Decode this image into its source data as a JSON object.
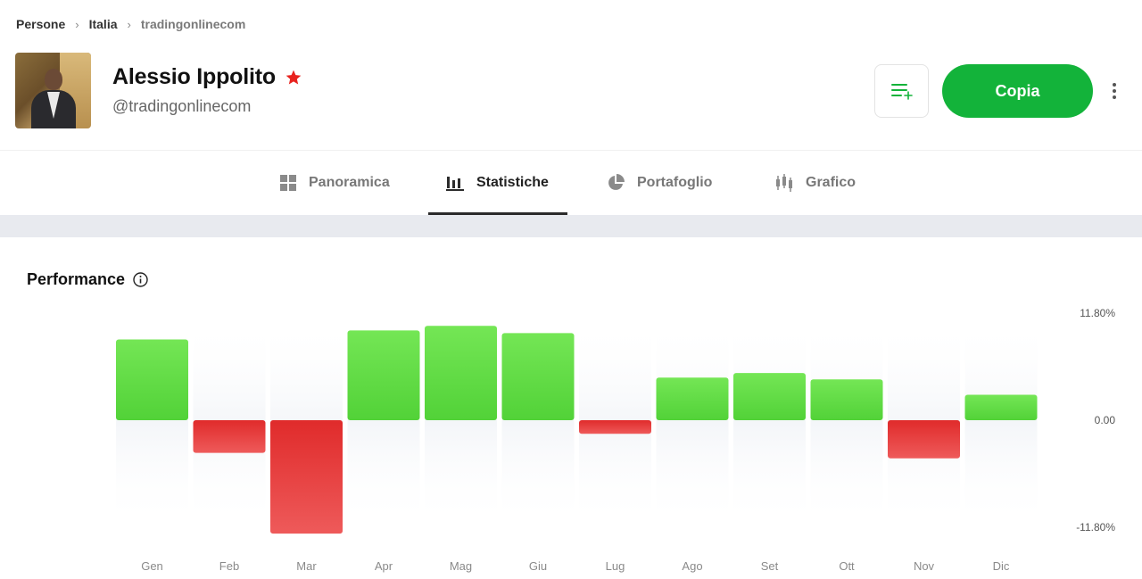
{
  "breadcrumb": {
    "items": [
      "Persone",
      "Italia",
      "tradingonlinecom"
    ]
  },
  "profile": {
    "name": "Alessio Ippolito",
    "handle": "@tradingonlinecom"
  },
  "actions": {
    "copy_label": "Copia"
  },
  "tabs": [
    {
      "label": "Panoramica",
      "icon": "grid-icon"
    },
    {
      "label": "Statistiche",
      "icon": "bar-chart-icon",
      "active": true
    },
    {
      "label": "Portafoglio",
      "icon": "pie-chart-icon"
    },
    {
      "label": "Grafico",
      "icon": "candlestick-icon"
    }
  ],
  "colors": {
    "accent": "#13b33a",
    "positive": "#5fdb46",
    "negative": "#e53a3a",
    "star": "#e8231f"
  },
  "performance": {
    "title": "Performance"
  },
  "chart_data": {
    "type": "bar",
    "categories": [
      "Gen",
      "Feb",
      "Mar",
      "Apr",
      "Mag",
      "Giu",
      "Lug",
      "Ago",
      "Set",
      "Ott",
      "Nov",
      "Dic"
    ],
    "values": [
      8.9,
      -3.6,
      -12.5,
      9.9,
      10.4,
      9.6,
      -1.5,
      4.7,
      5.2,
      4.5,
      -4.2,
      2.8
    ],
    "ytick_labels": [
      "11.80%",
      "0.00",
      "-11.80%"
    ],
    "ylim": [
      -11.8,
      11.8
    ],
    "grid": false
  }
}
